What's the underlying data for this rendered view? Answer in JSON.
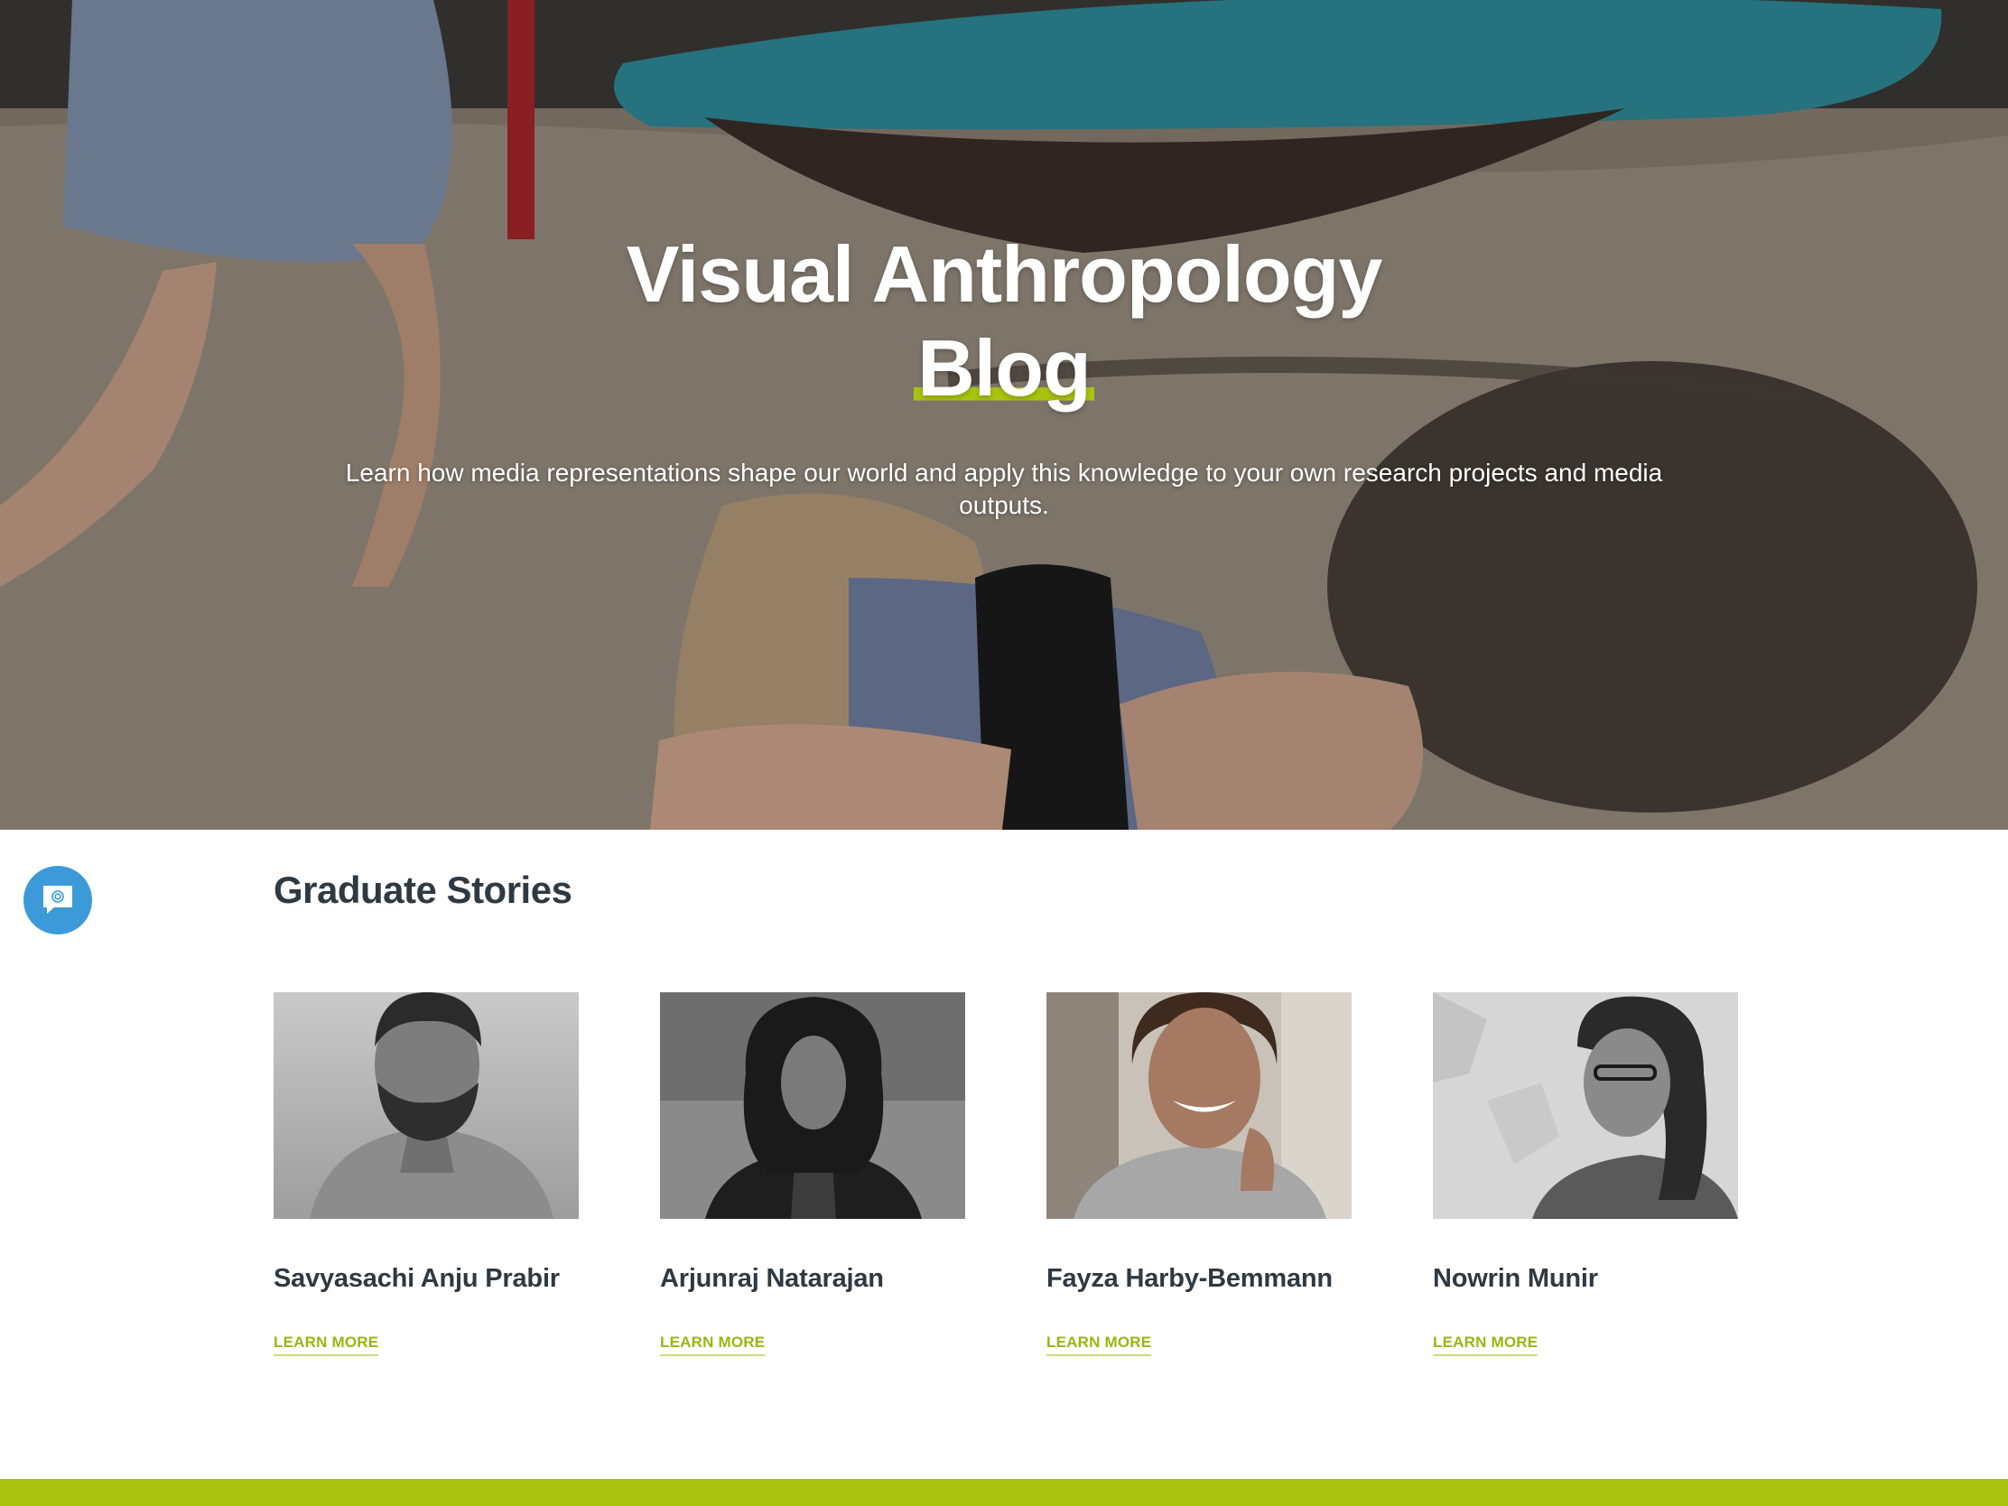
{
  "hero": {
    "title_line1": "Visual Anthropology",
    "title_line2": "Blog",
    "subtitle": "Learn how media representations shape our world and apply this knowledge to your own research projects and media outputs."
  },
  "chat": {
    "icon": "chat-bubble-icon"
  },
  "graduate_stories": {
    "title": "Graduate Stories",
    "items": [
      {
        "name": "Savyasachi Anju Prabir",
        "link": "LEARN MORE"
      },
      {
        "name": "Arjunraj Natarajan",
        "link": "LEARN MORE"
      },
      {
        "name": "Fayza Harby-Bemmann",
        "link": "LEARN MORE"
      },
      {
        "name": "Nowrin Munir",
        "link": "LEARN MORE"
      }
    ]
  },
  "colors": {
    "accent": "#a9c410",
    "link": "#9bb512",
    "heading": "#2f3942",
    "chat": "#3d9ad8"
  }
}
